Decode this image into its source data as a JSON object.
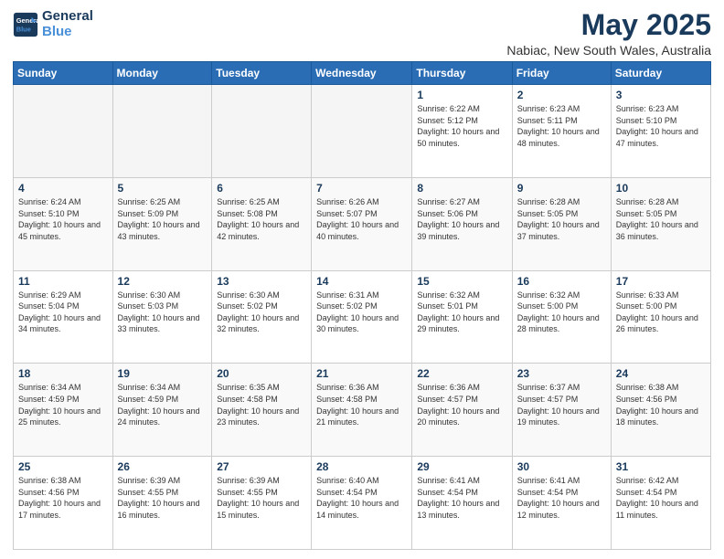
{
  "logo": {
    "line1": "General",
    "line2": "Blue"
  },
  "title": "May 2025",
  "subtitle": "Nabiac, New South Wales, Australia",
  "weekdays": [
    "Sunday",
    "Monday",
    "Tuesday",
    "Wednesday",
    "Thursday",
    "Friday",
    "Saturday"
  ],
  "weeks": [
    [
      {
        "day": "",
        "sunrise": "",
        "sunset": "",
        "daylight": ""
      },
      {
        "day": "",
        "sunrise": "",
        "sunset": "",
        "daylight": ""
      },
      {
        "day": "",
        "sunrise": "",
        "sunset": "",
        "daylight": ""
      },
      {
        "day": "",
        "sunrise": "",
        "sunset": "",
        "daylight": ""
      },
      {
        "day": "1",
        "sunrise": "Sunrise: 6:22 AM",
        "sunset": "Sunset: 5:12 PM",
        "daylight": "Daylight: 10 hours and 50 minutes."
      },
      {
        "day": "2",
        "sunrise": "Sunrise: 6:23 AM",
        "sunset": "Sunset: 5:11 PM",
        "daylight": "Daylight: 10 hours and 48 minutes."
      },
      {
        "day": "3",
        "sunrise": "Sunrise: 6:23 AM",
        "sunset": "Sunset: 5:10 PM",
        "daylight": "Daylight: 10 hours and 47 minutes."
      }
    ],
    [
      {
        "day": "4",
        "sunrise": "Sunrise: 6:24 AM",
        "sunset": "Sunset: 5:10 PM",
        "daylight": "Daylight: 10 hours and 45 minutes."
      },
      {
        "day": "5",
        "sunrise": "Sunrise: 6:25 AM",
        "sunset": "Sunset: 5:09 PM",
        "daylight": "Daylight: 10 hours and 43 minutes."
      },
      {
        "day": "6",
        "sunrise": "Sunrise: 6:25 AM",
        "sunset": "Sunset: 5:08 PM",
        "daylight": "Daylight: 10 hours and 42 minutes."
      },
      {
        "day": "7",
        "sunrise": "Sunrise: 6:26 AM",
        "sunset": "Sunset: 5:07 PM",
        "daylight": "Daylight: 10 hours and 40 minutes."
      },
      {
        "day": "8",
        "sunrise": "Sunrise: 6:27 AM",
        "sunset": "Sunset: 5:06 PM",
        "daylight": "Daylight: 10 hours and 39 minutes."
      },
      {
        "day": "9",
        "sunrise": "Sunrise: 6:28 AM",
        "sunset": "Sunset: 5:05 PM",
        "daylight": "Daylight: 10 hours and 37 minutes."
      },
      {
        "day": "10",
        "sunrise": "Sunrise: 6:28 AM",
        "sunset": "Sunset: 5:05 PM",
        "daylight": "Daylight: 10 hours and 36 minutes."
      }
    ],
    [
      {
        "day": "11",
        "sunrise": "Sunrise: 6:29 AM",
        "sunset": "Sunset: 5:04 PM",
        "daylight": "Daylight: 10 hours and 34 minutes."
      },
      {
        "day": "12",
        "sunrise": "Sunrise: 6:30 AM",
        "sunset": "Sunset: 5:03 PM",
        "daylight": "Daylight: 10 hours and 33 minutes."
      },
      {
        "day": "13",
        "sunrise": "Sunrise: 6:30 AM",
        "sunset": "Sunset: 5:02 PM",
        "daylight": "Daylight: 10 hours and 32 minutes."
      },
      {
        "day": "14",
        "sunrise": "Sunrise: 6:31 AM",
        "sunset": "Sunset: 5:02 PM",
        "daylight": "Daylight: 10 hours and 30 minutes."
      },
      {
        "day": "15",
        "sunrise": "Sunrise: 6:32 AM",
        "sunset": "Sunset: 5:01 PM",
        "daylight": "Daylight: 10 hours and 29 minutes."
      },
      {
        "day": "16",
        "sunrise": "Sunrise: 6:32 AM",
        "sunset": "Sunset: 5:00 PM",
        "daylight": "Daylight: 10 hours and 28 minutes."
      },
      {
        "day": "17",
        "sunrise": "Sunrise: 6:33 AM",
        "sunset": "Sunset: 5:00 PM",
        "daylight": "Daylight: 10 hours and 26 minutes."
      }
    ],
    [
      {
        "day": "18",
        "sunrise": "Sunrise: 6:34 AM",
        "sunset": "Sunset: 4:59 PM",
        "daylight": "Daylight: 10 hours and 25 minutes."
      },
      {
        "day": "19",
        "sunrise": "Sunrise: 6:34 AM",
        "sunset": "Sunset: 4:59 PM",
        "daylight": "Daylight: 10 hours and 24 minutes."
      },
      {
        "day": "20",
        "sunrise": "Sunrise: 6:35 AM",
        "sunset": "Sunset: 4:58 PM",
        "daylight": "Daylight: 10 hours and 23 minutes."
      },
      {
        "day": "21",
        "sunrise": "Sunrise: 6:36 AM",
        "sunset": "Sunset: 4:58 PM",
        "daylight": "Daylight: 10 hours and 21 minutes."
      },
      {
        "day": "22",
        "sunrise": "Sunrise: 6:36 AM",
        "sunset": "Sunset: 4:57 PM",
        "daylight": "Daylight: 10 hours and 20 minutes."
      },
      {
        "day": "23",
        "sunrise": "Sunrise: 6:37 AM",
        "sunset": "Sunset: 4:57 PM",
        "daylight": "Daylight: 10 hours and 19 minutes."
      },
      {
        "day": "24",
        "sunrise": "Sunrise: 6:38 AM",
        "sunset": "Sunset: 4:56 PM",
        "daylight": "Daylight: 10 hours and 18 minutes."
      }
    ],
    [
      {
        "day": "25",
        "sunrise": "Sunrise: 6:38 AM",
        "sunset": "Sunset: 4:56 PM",
        "daylight": "Daylight: 10 hours and 17 minutes."
      },
      {
        "day": "26",
        "sunrise": "Sunrise: 6:39 AM",
        "sunset": "Sunset: 4:55 PM",
        "daylight": "Daylight: 10 hours and 16 minutes."
      },
      {
        "day": "27",
        "sunrise": "Sunrise: 6:39 AM",
        "sunset": "Sunset: 4:55 PM",
        "daylight": "Daylight: 10 hours and 15 minutes."
      },
      {
        "day": "28",
        "sunrise": "Sunrise: 6:40 AM",
        "sunset": "Sunset: 4:54 PM",
        "daylight": "Daylight: 10 hours and 14 minutes."
      },
      {
        "day": "29",
        "sunrise": "Sunrise: 6:41 AM",
        "sunset": "Sunset: 4:54 PM",
        "daylight": "Daylight: 10 hours and 13 minutes."
      },
      {
        "day": "30",
        "sunrise": "Sunrise: 6:41 AM",
        "sunset": "Sunset: 4:54 PM",
        "daylight": "Daylight: 10 hours and 12 minutes."
      },
      {
        "day": "31",
        "sunrise": "Sunrise: 6:42 AM",
        "sunset": "Sunset: 4:54 PM",
        "daylight": "Daylight: 10 hours and 11 minutes."
      }
    ]
  ]
}
